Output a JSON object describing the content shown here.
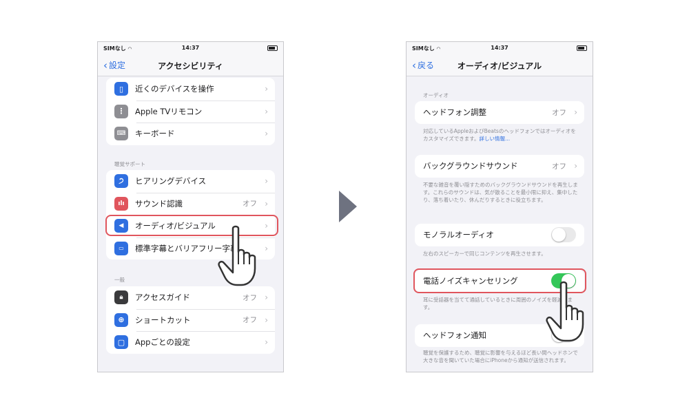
{
  "colors": {
    "accent": "#2f6fe0",
    "highlight": "#e0555d",
    "toggle_on": "#34c759",
    "arrow": "#6e7280"
  },
  "left": {
    "status": {
      "carrier": "SIMなし",
      "time": "14:37"
    },
    "nav": {
      "back": "設定",
      "title": "アクセシビリティ"
    },
    "group1": [
      {
        "label": "近くのデバイスを操作",
        "icon": "device-icon"
      },
      {
        "label": "Apple TVリモコン",
        "icon": "remote-icon"
      },
      {
        "label": "キーボード",
        "icon": "keyboard-icon"
      }
    ],
    "section_hearing": "聴覚サポート",
    "group2": [
      {
        "label": "ヒアリングデバイス",
        "icon": "ear-icon"
      },
      {
        "label": "サウンド認識",
        "value": "オフ",
        "icon": "waveform-icon"
      },
      {
        "label": "オーディオ/ビジュアル",
        "icon": "speaker-eye-icon"
      },
      {
        "label": "標準字幕とバリアフリー字幕",
        "icon": "captions-icon"
      }
    ],
    "section_general": "一般",
    "group3": [
      {
        "label": "アクセスガイド",
        "value": "オフ",
        "icon": "lock-frame-icon"
      },
      {
        "label": "ショートカット",
        "value": "オフ",
        "icon": "accessibility-icon"
      },
      {
        "label": "Appごとの設定",
        "icon": "app-settings-icon"
      }
    ]
  },
  "right": {
    "status": {
      "carrier": "SIMなし",
      "time": "14:37"
    },
    "nav": {
      "back": "戻る",
      "title": "オーディオ/ビジュアル"
    },
    "section_audio": "オーディオ",
    "headphone_adjust": {
      "label": "ヘッドフォン調整",
      "value": "オフ"
    },
    "headphone_adjust_foot": "対応しているAppleおよびBeatsのヘッドフォンではオーディオをカスタマイズできます。",
    "headphone_adjust_link": "詳しい情報...",
    "background_sounds": {
      "label": "バックグラウンドサウンド",
      "value": "オフ"
    },
    "background_sounds_foot": "不要な雑音を覆い隠すためのバックグラウンドサウンドを再生します。これらのサウンドは、気が散ることを最小限に抑え、集中したり、落ち着いたり、休んだりするときに役立ちます。",
    "mono_audio": {
      "label": "モノラルオーディオ",
      "on": false
    },
    "mono_audio_foot": "左右のスピーカーで同じコンテンツを再生させます。",
    "noise_cancel": {
      "label": "電話ノイズキャンセリング",
      "on": true
    },
    "noise_cancel_foot": "耳に受話器を当てて通話しているときに周囲のノイズを軽減します。",
    "headphone_notify": {
      "label": "ヘッドフォン通知",
      "on": false
    },
    "headphone_notify_foot": "聴覚を保護するため、聴覚に影響を与えるほど長い間ヘッドホンで大きな音を聞いていた場合にiPhoneから通知が送信されます。"
  }
}
